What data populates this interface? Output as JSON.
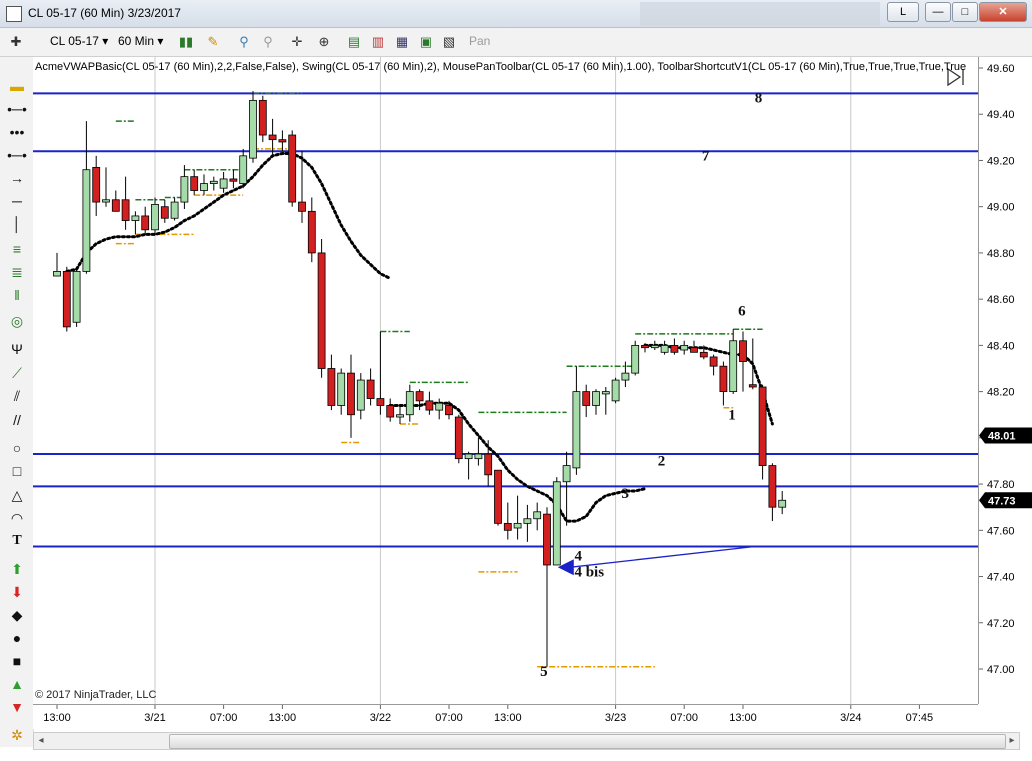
{
  "window": {
    "title": "CL 05-17 (60 Min)  3/23/2017",
    "buttons": {
      "help": "L",
      "minimize": "—",
      "maximize": "□",
      "close": "✕"
    }
  },
  "toolbar": {
    "instrument": "CL 05-17",
    "interval": "60 Min",
    "pan_label": "Pan"
  },
  "indicators_text": "AcmeVWAPBasic(CL 05-17 (60 Min),2,2,False,False), Swing(CL 05-17 (60 Min),2), MousePanToolbar(CL 05-17 (60 Min),1.00), ToolbarShortcutV1(CL 05-17 (60 Min),True,True,True,True,True",
  "copyright": "© 2017 NinjaTrader, LLC",
  "colors": {
    "up_fill": "#a4dba8",
    "down_fill": "#d21f1f",
    "level_line": "#1a23c8",
    "vwap": "#000000",
    "swing_high": "#1d7a1d",
    "swing_low": "#e39a00",
    "arrow": "#1a23c8"
  },
  "chart_data": {
    "type": "candlestick",
    "instrument": "CL 05-17",
    "interval": "60 Min",
    "ylim": [
      46.87,
      49.62
    ],
    "y_ticks": [
      49.6,
      49.4,
      49.2,
      49.0,
      48.8,
      48.6,
      48.4,
      48.2,
      48.0,
      47.8,
      47.6,
      47.4,
      47.2,
      47.0
    ],
    "x_ticks": [
      "13:00",
      "3/21",
      "07:00",
      "13:00",
      "3/22",
      "07:00",
      "13:00",
      "3/23",
      "07:00",
      "13:00",
      "3/24",
      "07:45"
    ],
    "x_tick_bars": [
      0,
      10,
      17,
      23,
      33,
      40,
      46,
      57,
      64,
      70,
      81,
      88
    ],
    "day_separators": [
      10,
      33,
      57,
      81
    ],
    "candles": [
      {
        "o": 48.7,
        "h": 48.8,
        "l": 48.7,
        "c": 48.72
      },
      {
        "o": 48.72,
        "h": 48.74,
        "l": 48.46,
        "c": 48.48
      },
      {
        "o": 48.5,
        "h": 48.74,
        "l": 48.48,
        "c": 48.72
      },
      {
        "o": 48.72,
        "h": 49.37,
        "l": 48.71,
        "c": 49.16
      },
      {
        "o": 49.17,
        "h": 49.22,
        "l": 48.96,
        "c": 49.02
      },
      {
        "o": 49.02,
        "h": 49.17,
        "l": 49.0,
        "c": 49.03
      },
      {
        "o": 49.03,
        "h": 49.07,
        "l": 48.98,
        "c": 48.98
      },
      {
        "o": 49.03,
        "h": 49.13,
        "l": 48.9,
        "c": 48.94
      },
      {
        "o": 48.94,
        "h": 48.98,
        "l": 48.88,
        "c": 48.96
      },
      {
        "o": 48.96,
        "h": 49.0,
        "l": 48.88,
        "c": 48.9
      },
      {
        "o": 48.9,
        "h": 49.04,
        "l": 48.88,
        "c": 49.01
      },
      {
        "o": 49.0,
        "h": 49.03,
        "l": 48.93,
        "c": 48.95
      },
      {
        "o": 48.95,
        "h": 49.04,
        "l": 48.94,
        "c": 49.02
      },
      {
        "o": 49.02,
        "h": 49.18,
        "l": 48.99,
        "c": 49.13
      },
      {
        "o": 49.13,
        "h": 49.16,
        "l": 49.05,
        "c": 49.07
      },
      {
        "o": 49.07,
        "h": 49.14,
        "l": 49.05,
        "c": 49.1
      },
      {
        "o": 49.1,
        "h": 49.13,
        "l": 49.07,
        "c": 49.11
      },
      {
        "o": 49.08,
        "h": 49.15,
        "l": 49.06,
        "c": 49.12
      },
      {
        "o": 49.12,
        "h": 49.16,
        "l": 49.08,
        "c": 49.11
      },
      {
        "o": 49.1,
        "h": 49.25,
        "l": 49.08,
        "c": 49.22
      },
      {
        "o": 49.21,
        "h": 49.5,
        "l": 49.19,
        "c": 49.46
      },
      {
        "o": 49.46,
        "h": 49.48,
        "l": 49.28,
        "c": 49.31
      },
      {
        "o": 49.31,
        "h": 49.38,
        "l": 49.22,
        "c": 49.29
      },
      {
        "o": 49.29,
        "h": 49.33,
        "l": 49.24,
        "c": 49.28
      },
      {
        "o": 49.31,
        "h": 49.33,
        "l": 49.0,
        "c": 49.02
      },
      {
        "o": 49.02,
        "h": 49.24,
        "l": 48.93,
        "c": 48.98
      },
      {
        "o": 48.98,
        "h": 49.04,
        "l": 48.76,
        "c": 48.8
      },
      {
        "o": 48.8,
        "h": 48.86,
        "l": 48.26,
        "c": 48.3
      },
      {
        "o": 48.3,
        "h": 48.36,
        "l": 48.12,
        "c": 48.14
      },
      {
        "o": 48.14,
        "h": 48.3,
        "l": 48.1,
        "c": 48.28
      },
      {
        "o": 48.28,
        "h": 48.36,
        "l": 48.0,
        "c": 48.1
      },
      {
        "o": 48.12,
        "h": 48.28,
        "l": 48.08,
        "c": 48.25
      },
      {
        "o": 48.25,
        "h": 48.3,
        "l": 48.14,
        "c": 48.17
      },
      {
        "o": 48.17,
        "h": 48.46,
        "l": 48.1,
        "c": 48.14
      },
      {
        "o": 48.14,
        "h": 48.17,
        "l": 48.07,
        "c": 48.09
      },
      {
        "o": 48.09,
        "h": 48.14,
        "l": 48.06,
        "c": 48.1
      },
      {
        "o": 48.1,
        "h": 48.23,
        "l": 48.07,
        "c": 48.2
      },
      {
        "o": 48.2,
        "h": 48.21,
        "l": 48.12,
        "c": 48.16
      },
      {
        "o": 48.16,
        "h": 48.2,
        "l": 48.1,
        "c": 48.12
      },
      {
        "o": 48.12,
        "h": 48.17,
        "l": 48.08,
        "c": 48.15
      },
      {
        "o": 48.14,
        "h": 48.16,
        "l": 48.08,
        "c": 48.1
      },
      {
        "o": 48.09,
        "h": 48.1,
        "l": 47.89,
        "c": 47.91
      },
      {
        "o": 47.91,
        "h": 47.94,
        "l": 47.82,
        "c": 47.93
      },
      {
        "o": 47.91,
        "h": 48.0,
        "l": 47.88,
        "c": 47.93
      },
      {
        "o": 47.93,
        "h": 47.99,
        "l": 47.79,
        "c": 47.84
      },
      {
        "o": 47.86,
        "h": 47.86,
        "l": 47.62,
        "c": 47.63
      },
      {
        "o": 47.63,
        "h": 47.72,
        "l": 47.56,
        "c": 47.6
      },
      {
        "o": 47.61,
        "h": 47.75,
        "l": 47.56,
        "c": 47.63
      },
      {
        "o": 47.63,
        "h": 47.71,
        "l": 47.55,
        "c": 47.65
      },
      {
        "o": 47.65,
        "h": 47.72,
        "l": 47.6,
        "c": 47.68
      },
      {
        "o": 47.67,
        "h": 47.7,
        "l": 47.01,
        "c": 47.45
      },
      {
        "o": 47.45,
        "h": 47.83,
        "l": 47.45,
        "c": 47.81
      },
      {
        "o": 47.81,
        "h": 47.94,
        "l": 47.62,
        "c": 47.88
      },
      {
        "o": 47.87,
        "h": 48.31,
        "l": 47.84,
        "c": 48.2
      },
      {
        "o": 48.2,
        "h": 48.23,
        "l": 48.09,
        "c": 48.14
      },
      {
        "o": 48.14,
        "h": 48.21,
        "l": 48.1,
        "c": 48.2
      },
      {
        "o": 48.19,
        "h": 48.22,
        "l": 48.1,
        "c": 48.2
      },
      {
        "o": 48.16,
        "h": 48.26,
        "l": 48.15,
        "c": 48.25
      },
      {
        "o": 48.25,
        "h": 48.33,
        "l": 48.22,
        "c": 48.28
      },
      {
        "o": 48.28,
        "h": 48.42,
        "l": 48.27,
        "c": 48.4
      },
      {
        "o": 48.4,
        "h": 48.41,
        "l": 48.37,
        "c": 48.39
      },
      {
        "o": 48.39,
        "h": 48.42,
        "l": 48.38,
        "c": 48.4
      },
      {
        "o": 48.37,
        "h": 48.42,
        "l": 48.36,
        "c": 48.4
      },
      {
        "o": 48.4,
        "h": 48.43,
        "l": 48.36,
        "c": 48.37
      },
      {
        "o": 48.38,
        "h": 48.42,
        "l": 48.36,
        "c": 48.4
      },
      {
        "o": 48.39,
        "h": 48.42,
        "l": 48.37,
        "c": 48.37
      },
      {
        "o": 48.37,
        "h": 48.4,
        "l": 48.34,
        "c": 48.35
      },
      {
        "o": 48.35,
        "h": 48.36,
        "l": 48.27,
        "c": 48.31
      },
      {
        "o": 48.31,
        "h": 48.33,
        "l": 48.14,
        "c": 48.2
      },
      {
        "o": 48.2,
        "h": 48.47,
        "l": 48.19,
        "c": 48.42
      },
      {
        "o": 48.42,
        "h": 48.46,
        "l": 48.2,
        "c": 48.33
      },
      {
        "o": 48.23,
        "h": 48.43,
        "l": 48.21,
        "c": 48.22
      },
      {
        "o": 48.22,
        "h": 48.23,
        "l": 47.82,
        "c": 47.88
      },
      {
        "o": 47.88,
        "h": 47.89,
        "l": 47.64,
        "c": 47.7
      },
      {
        "o": 47.7,
        "h": 47.77,
        "l": 47.67,
        "c": 47.73
      }
    ],
    "vwap_segments": [
      {
        "start_bar": 1,
        "values": [
          48.72,
          48.73,
          48.8,
          48.84,
          48.86,
          48.87,
          48.87,
          48.87,
          48.88,
          48.88,
          48.89,
          48.91,
          48.94,
          48.96,
          48.99,
          49.02,
          49.05,
          49.07,
          49.09,
          49.13,
          49.18,
          49.22,
          49.23,
          49.23,
          49.21,
          49.17,
          49.1,
          49.01,
          48.92,
          48.85,
          48.79,
          48.75,
          48.71,
          48.69
        ]
      },
      {
        "start_bar": 34,
        "values": [
          48.14,
          48.14,
          48.14,
          48.14,
          48.15,
          48.15,
          48.15,
          48.12,
          48.06,
          48.01,
          47.96,
          47.92,
          47.86,
          47.82,
          47.79,
          47.77,
          47.75,
          47.71,
          47.64,
          47.64,
          47.66,
          47.72,
          47.75,
          47.76,
          47.77,
          47.77,
          47.78
        ]
      },
      {
        "start_bar": 60,
        "values": [
          48.4,
          48.4,
          48.4,
          48.39,
          48.39,
          48.39,
          48.39,
          48.38,
          48.37,
          48.36,
          48.36,
          48.32,
          48.2,
          48.06
        ]
      }
    ],
    "swing_highs": [
      {
        "value": 49.37,
        "from_bar": 6,
        "to_bar": 8
      },
      {
        "value": 49.03,
        "from_bar": 8,
        "to_bar": 11
      },
      {
        "value": 49.04,
        "from_bar": 11,
        "to_bar": 13
      },
      {
        "value": 49.16,
        "from_bar": 13,
        "to_bar": 19
      },
      {
        "value": 49.49,
        "from_bar": 20,
        "to_bar": 25
      },
      {
        "value": 48.46,
        "from_bar": 33,
        "to_bar": 36
      },
      {
        "value": 48.24,
        "from_bar": 36,
        "to_bar": 42
      },
      {
        "value": 48.11,
        "from_bar": 43,
        "to_bar": 52
      },
      {
        "value": 48.31,
        "from_bar": 52,
        "to_bar": 59
      },
      {
        "value": 48.45,
        "from_bar": 59,
        "to_bar": 69
      },
      {
        "value": 48.47,
        "from_bar": 69,
        "to_bar": 72
      }
    ],
    "swing_lows": [
      {
        "value": 48.84,
        "from_bar": 6,
        "to_bar": 8
      },
      {
        "value": 48.88,
        "from_bar": 8,
        "to_bar": 14
      },
      {
        "value": 49.05,
        "from_bar": 14,
        "to_bar": 19
      },
      {
        "value": 49.25,
        "from_bar": 20,
        "to_bar": 24
      },
      {
        "value": 47.98,
        "from_bar": 29,
        "to_bar": 31
      },
      {
        "value": 48.06,
        "from_bar": 35,
        "to_bar": 37
      },
      {
        "value": 47.42,
        "from_bar": 43,
        "to_bar": 47
      },
      {
        "value": 47.01,
        "from_bar": 49,
        "to_bar": 61
      },
      {
        "value": 48.13,
        "from_bar": 68,
        "to_bar": 69
      }
    ],
    "horizontal_lines": [
      49.49,
      49.24,
      47.93,
      47.79,
      47.53
    ],
    "level_labels": [
      {
        "text": "8",
        "bar": 71.2,
        "value": 49.45
      },
      {
        "text": "7",
        "bar": 65.8,
        "value": 49.2
      },
      {
        "text": "6",
        "bar": 69.5,
        "value": 48.53
      },
      {
        "text": "1",
        "bar": 68.5,
        "value": 48.08
      },
      {
        "text": "2",
        "bar": 61.3,
        "value": 47.88
      },
      {
        "text": "3",
        "bar": 57.6,
        "value": 47.74
      },
      {
        "text": "4",
        "bar": 52.8,
        "value": 47.47
      },
      {
        "text": "4 bis",
        "bar": 52.8,
        "value": 47.4
      },
      {
        "text": "5",
        "bar": 49.3,
        "value": 46.97
      }
    ],
    "arrow": {
      "from_bar": 71.2,
      "from_value": 47.53,
      "to_bar": 51.1,
      "to_value": 47.44
    },
    "price_markers": [
      {
        "label": "48.01",
        "value": 48.01,
        "color": "#000000"
      },
      {
        "label": "47.73",
        "value": 47.73,
        "color": "#000000"
      }
    ],
    "title": "",
    "xlabel": "",
    "ylabel": ""
  }
}
